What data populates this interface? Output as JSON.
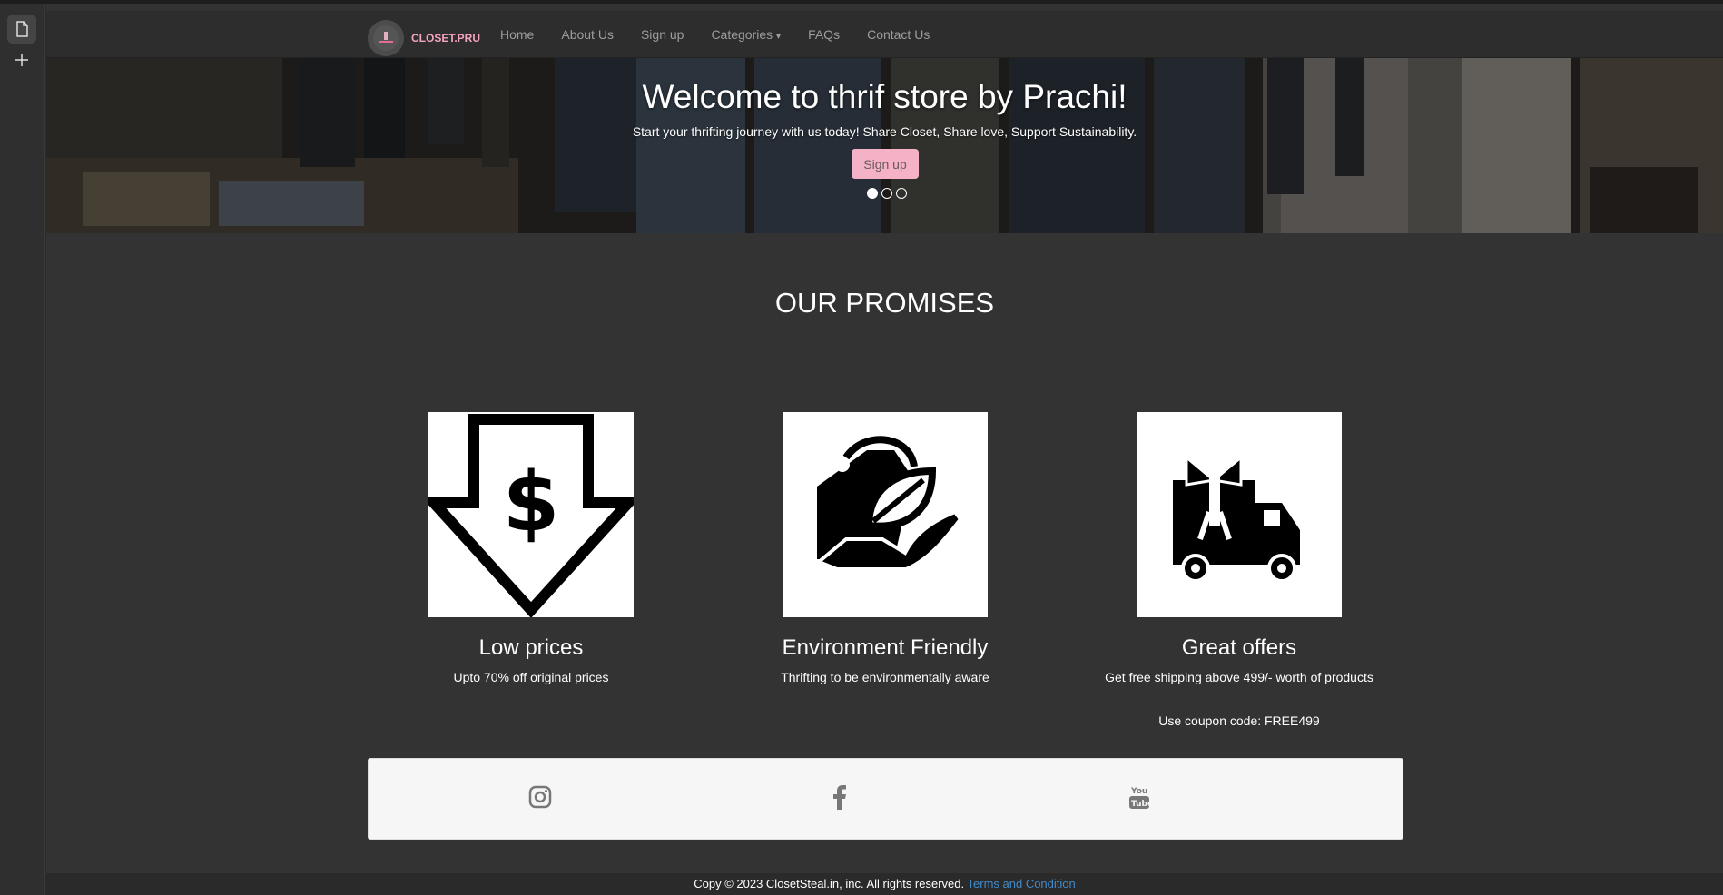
{
  "brand": {
    "name": "CLOSET.PRU"
  },
  "nav": {
    "links": [
      "Home",
      "About Us",
      "Sign up",
      "Categories",
      "FAQs",
      "Contact Us"
    ],
    "categories_caret": "▾"
  },
  "hero": {
    "title": "Welcome to thrif store by Prachi!",
    "subtitle": "Start your thrifting journey with us today! Share Closet, Share love, Support Sustainability.",
    "button": "Sign up",
    "slides": 3,
    "active_slide": 1
  },
  "promises": {
    "title": "OUR PROMISES",
    "cards": [
      {
        "icon": "price-down-arrow-icon",
        "title": "Low prices",
        "desc": "Upto 70% off original prices"
      },
      {
        "icon": "eco-tag-leaf-icon",
        "title": "Environment Friendly",
        "desc": "Thrifting to be environmentally aware"
      },
      {
        "icon": "gift-truck-icon",
        "title": "Great offers",
        "desc": "Get free shipping above 499/- worth of products",
        "desc2": "Use coupon code: FREE499"
      }
    ]
  },
  "social": {
    "icons": [
      "instagram-icon",
      "facebook-icon",
      "youtube-icon"
    ]
  },
  "footer": {
    "text": "Copy © 2023 ClosetSteal.in, inc. All rights reserved.",
    "link": "Terms and Condition"
  },
  "colors": {
    "accent_pink": "#f5b1c5",
    "link_blue": "#428bca",
    "page_bg": "#333333"
  }
}
